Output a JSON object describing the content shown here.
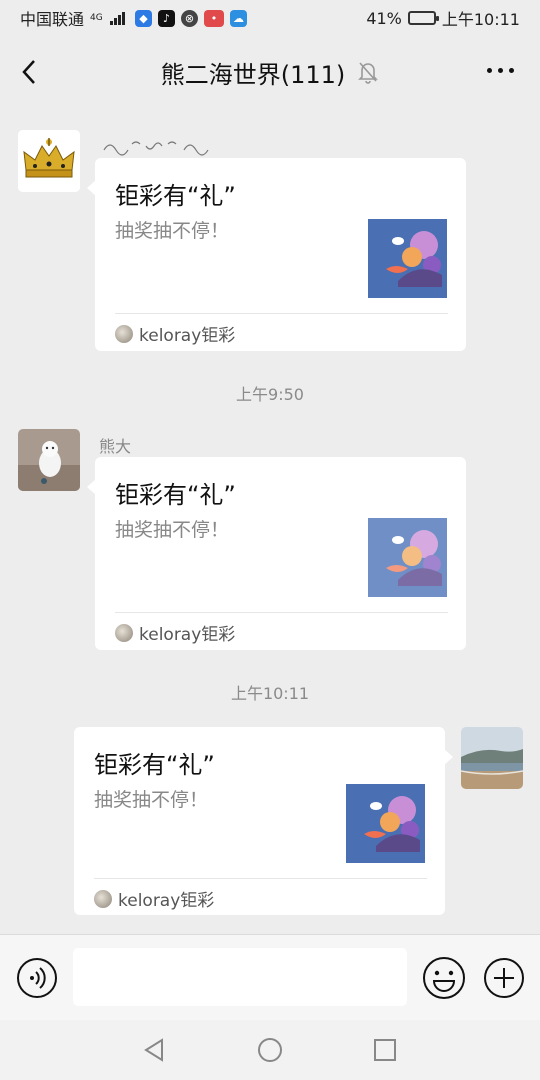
{
  "status_bar": {
    "carrier": "中国联通",
    "network": "4G",
    "battery": "41%",
    "battery_level": 0.41,
    "time": "上午10:11",
    "apps": [
      "shield-app-icon",
      "tiktok-app-icon",
      "browser-app-icon",
      "red-app-icon",
      "cloud-app-icon"
    ]
  },
  "header": {
    "title": "熊二海世界(111)",
    "icons": [
      "back-icon",
      "mute-bell-icon",
      "more-icon"
    ]
  },
  "messages": [
    {
      "sender": "",
      "avatar": "crown-avatar",
      "card": {
        "title": "钜彩有“礼”",
        "description": "抽奖抽不停！",
        "source": "keloray钜彩"
      }
    },
    {
      "timestamp": "上午9:50",
      "sender": "熊大",
      "avatar": "polar-bear-avatar",
      "card": {
        "title": "钜彩有“礼”",
        "description": "抽奖抽不停！",
        "source": "keloray钜彩"
      }
    },
    {
      "timestamp": "上午10:11",
      "sender": "",
      "avatar": "beach-avatar",
      "card": {
        "title": "钜彩有“礼”",
        "description": "抽奖抽不停！",
        "source": "keloray钜彩"
      }
    }
  ],
  "input_bar": {
    "placeholder": "",
    "icons": [
      "voice-icon",
      "emoji-icon",
      "plus-icon"
    ]
  },
  "system_nav": [
    "back-triangle-icon",
    "home-circle-icon",
    "recents-square-icon"
  ]
}
